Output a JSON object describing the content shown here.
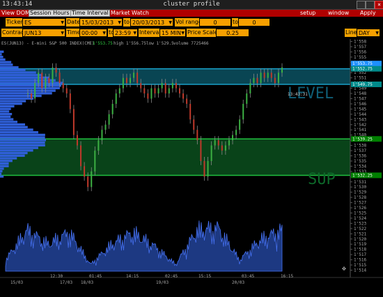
{
  "window": {
    "clock": "13:43:14",
    "title": "cluster profile",
    "close_glyph": "×"
  },
  "menu": {
    "left": [
      "View DOM",
      "Session Hours",
      "Time Interval",
      "Market Watch"
    ],
    "right": [
      "setup",
      "window",
      "Apply"
    ]
  },
  "controls": {
    "ticker_label": "Ticker",
    "ticker": "ES",
    "date_label": "Date",
    "date_from": "15/03/2013",
    "to_label": "to",
    "date_to": "20/03/2013",
    "vol_range_label": "Vol range",
    "vol_from": "0",
    "vol_to_label": "to",
    "vol_to": "0",
    "contract_label": "Contract",
    "contract": "JUN13",
    "time_label": "Time",
    "time_from": "00:00",
    "time_to_label": "to",
    "time_to": "23:59",
    "interval_label": "Interval",
    "interval": "15 MIN",
    "price_scale_label": "Price Scale",
    "price_scale": "0.25",
    "line_label": "Line",
    "line": "DAY"
  },
  "chart_info": {
    "symbol": "ES(JUN13) - E-mini S&P 500 INDEX(CME)",
    "last": "1'553.75",
    "high_text": "high 1'556.75",
    "low_text": "low 1'529.5",
    "volume_text": "volume 7725466",
    "cursor_time": "13:43:31",
    "zone_upper_label": "LEVEL",
    "zone_lower_label": "SUP"
  },
  "chart_data": {
    "type": "candlestick",
    "price_axis": {
      "ticks": [
        "1'558",
        "1'557",
        "1'556",
        "1'555",
        "1'554",
        "1'553",
        "1'552",
        "1'551",
        "1'550",
        "1'549",
        "1'548",
        "1'547",
        "1'546",
        "1'545",
        "1'544",
        "1'543",
        "1'542",
        "1'541",
        "1'540",
        "1'539",
        "1'538",
        "1'537",
        "1'536",
        "1'535",
        "1'534",
        "1'533",
        "1'532",
        "1'531",
        "1'530",
        "1'529",
        "1'528",
        "1'527",
        "1'526",
        "1'525",
        "1'524",
        "1'523",
        "1'522",
        "1'521",
        "1'520",
        "1'519",
        "1'518",
        "1'517",
        "1'516",
        "1'515",
        "1'514"
      ],
      "ylim": [
        1513.8,
        1558.2
      ]
    },
    "price_tags": [
      {
        "text": "1'553.75",
        "value": 1553.75,
        "color": "#1e90ff"
      },
      {
        "text": "1'552.75",
        "value": 1552.75,
        "color": "#008b8b"
      },
      {
        "text": "1'549.75",
        "value": 1549.75,
        "color": "#008b8b"
      },
      {
        "text": "1'539.25",
        "value": 1539.25,
        "color": "#008000"
      },
      {
        "text": "1'532.25",
        "value": 1532.25,
        "color": "#008000"
      }
    ],
    "zones": [
      {
        "name": "LEVEL",
        "from": 1549.75,
        "to": 1552.75,
        "color": "#0a4d5c"
      },
      {
        "name": "SUP",
        "from": 1532.25,
        "to": 1539.25,
        "color": "#0a4a1c"
      }
    ],
    "time_axis": {
      "labels": [
        "15/03",
        "12:30",
        "17/03",
        "18/03",
        "01:45",
        "14:15",
        "19/03",
        "02:45",
        "15:15",
        "20/03",
        "03:45",
        "16:15"
      ]
    },
    "price_path": [
      1548,
      1547,
      1550,
      1552,
      1549,
      1551,
      1550,
      1553,
      1552,
      1550,
      1549,
      1548,
      1545,
      1540,
      1538,
      1534,
      1532,
      1530,
      1533,
      1537,
      1539,
      1541,
      1542,
      1544,
      1546,
      1548,
      1549,
      1551,
      1550,
      1551,
      1552,
      1550,
      1549,
      1548,
      1547,
      1549,
      1548,
      1549,
      1550,
      1548,
      1549,
      1550,
      1549,
      1548,
      1547,
      1546,
      1543,
      1541,
      1539,
      1535,
      1532,
      1535,
      1538,
      1539,
      1538,
      1537,
      1538,
      1539,
      1540,
      1541,
      1543,
      1546,
      1548,
      1550,
      1551,
      1550,
      1552,
      1551,
      1552,
      1551,
      1550,
      1552,
      1553
    ],
    "volume_peaks": [
      0.25,
      0.9,
      0.6,
      0.85,
      0.15,
      0.6,
      0.85,
      0.55,
      0.15,
      0.9,
      0.95,
      0.25,
      0.7,
      0.9
    ]
  }
}
